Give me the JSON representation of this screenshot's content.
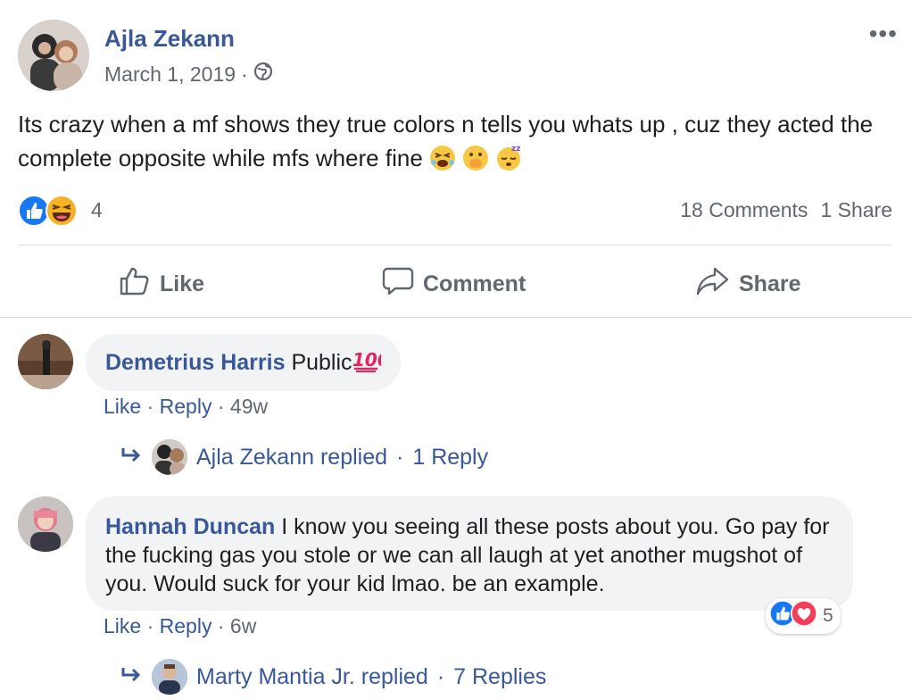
{
  "post": {
    "author": "Ajla Zekann",
    "date": "March 1, 2019",
    "date_separator": "·",
    "privacy_icon": "globe-icon",
    "more_label": "•••",
    "text": "Its crazy when a mf shows they true colors n tells you whats up , cuz they acted the complete opposite while mfs where fine",
    "text_emojis": [
      "squinting-face-emoji",
      "hand-over-mouth-emoji",
      "sleeping-face-emoji"
    ],
    "reaction_icons": [
      "like-reaction-icon",
      "haha-reaction-icon"
    ],
    "reaction_count": "4",
    "comments_count": "18 Comments",
    "shares_count": "1 Share"
  },
  "actions": {
    "like": "Like",
    "comment": "Comment",
    "share": "Share"
  },
  "comments": [
    {
      "author": "Demetrius Harris",
      "text": "Public",
      "emoji": "hundred-points-emoji",
      "like": "Like",
      "reply": "Reply",
      "sep": "·",
      "time": "49w",
      "replies": {
        "author_replied": "Ajla Zekann replied",
        "sep": "·",
        "count": "1 Reply"
      }
    },
    {
      "author": "Hannah Duncan",
      "text": "I know you seeing all these posts about you. Go pay for the fucking gas you stole or we can all laugh at yet another mugshot of you. Would suck for your kid lmao. be an example.",
      "like": "Like",
      "reply": "Reply",
      "sep": "·",
      "time": "6w",
      "reaction_count": "5",
      "reaction_icons": [
        "like-reaction-icon",
        "love-reaction-icon"
      ],
      "replies": {
        "author_replied": "Marty Mantia Jr. replied",
        "sep": "·",
        "count": "7 Replies"
      }
    }
  ],
  "colors": {
    "link": "#385898",
    "muted": "#606770",
    "bubble": "#f2f3f5",
    "like_blue": "#1877f2",
    "love_red": "#f33e58",
    "haha_yellow": "#f7b125"
  }
}
